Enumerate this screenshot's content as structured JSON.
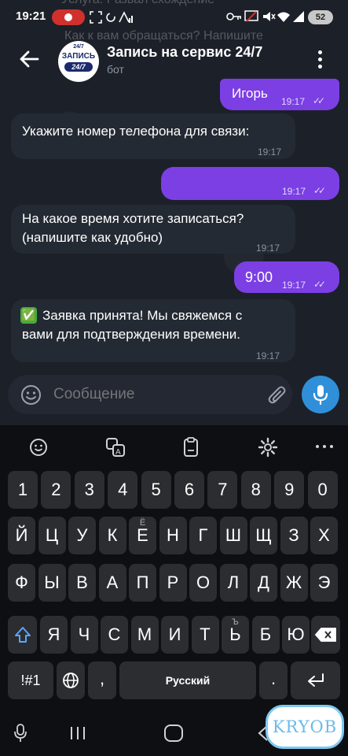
{
  "status_bar": {
    "time": "19:21",
    "faded_line1": "Услуга: Развал схождение",
    "faded_line2": "Как к вам обращаться? Напишите",
    "battery": "52"
  },
  "header": {
    "title": "Запись на сервис 24/7",
    "subtitle": "бот",
    "avatar_line1": "ЗАПИСЬ",
    "avatar_line2": "24/7",
    "avatar_top": "24/7"
  },
  "messages": [
    {
      "id": "m1",
      "dir": "out",
      "text": "Игорь",
      "time": "19:17"
    },
    {
      "id": "m2",
      "dir": "in",
      "text": "Укажите номер телефона для связи:",
      "time": "19:17"
    },
    {
      "id": "m3",
      "dir": "out",
      "text": "",
      "time": "19:17"
    },
    {
      "id": "m4",
      "dir": "in",
      "line1": "На какое время хотите записаться?",
      "line2": "(напишите как удобно)",
      "time": "19:17"
    },
    {
      "id": "m5",
      "dir": "out",
      "text": "9:00",
      "time": "19:17"
    },
    {
      "id": "m6",
      "dir": "in",
      "emoji": "✅",
      "line1": "Заявка принята! Мы свяжемся с",
      "line2": "вами для подтверждения времени.",
      "time": "19:17"
    }
  ],
  "composer": {
    "placeholder": "Сообщение"
  },
  "keyboard": {
    "row_numbers": [
      "1",
      "2",
      "3",
      "4",
      "5",
      "6",
      "7",
      "8",
      "9",
      "0"
    ],
    "row1": [
      "Й",
      "Ц",
      "У",
      "К",
      "Е",
      "Н",
      "Г",
      "Ш",
      "Щ",
      "З",
      "Х"
    ],
    "row1_sup": {
      "Е": "Ё"
    },
    "row2": [
      "Ф",
      "Ы",
      "В",
      "А",
      "П",
      "Р",
      "О",
      "Л",
      "Д",
      "Ж",
      "Э"
    ],
    "row3": [
      "Я",
      "Ч",
      "С",
      "М",
      "И",
      "Т",
      "Ь",
      "Б",
      "Ю"
    ],
    "row3_sup": {
      "Ь": "Ъ"
    },
    "sym_key": "!#1",
    "space_label": "Русский",
    "comma": ",",
    "period": "."
  },
  "watermark": "KRYOB",
  "colors": {
    "accent": "#7b3fe4",
    "incoming": "#242a33",
    "mic": "#2f8fd8"
  }
}
